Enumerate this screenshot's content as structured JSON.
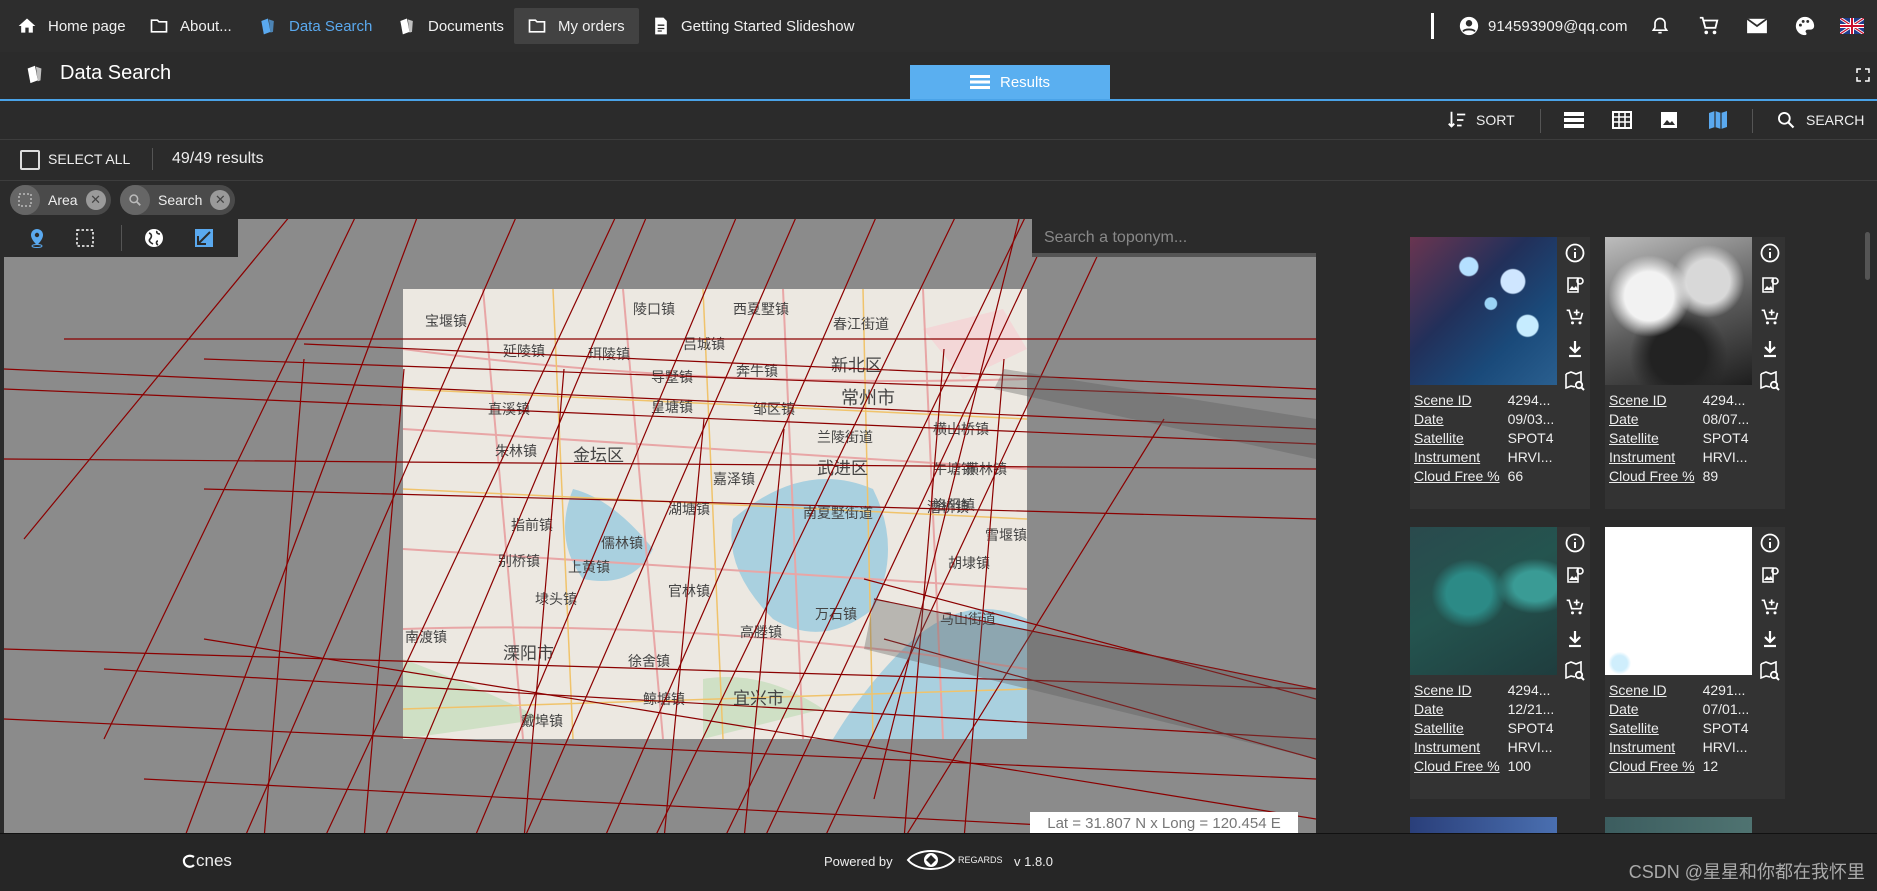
{
  "nav": {
    "items": [
      {
        "label": "Home page",
        "icon": "home-icon"
      },
      {
        "label": "About...",
        "icon": "folder-icon"
      },
      {
        "label": "Data Search",
        "icon": "data-search-icon"
      },
      {
        "label": "Documents",
        "icon": "documents-icon"
      },
      {
        "label": "My orders",
        "icon": "folder-icon"
      },
      {
        "label": "Getting Started Slideshow",
        "icon": "document-icon"
      }
    ],
    "user_email": "914593909@qq.com",
    "accent": "#5aa9ef"
  },
  "page": {
    "title": "Data Search",
    "tab_results": "Results"
  },
  "toolbar": {
    "sort_label": "SORT",
    "search_label": "SEARCH"
  },
  "selection": {
    "select_all": "SELECT ALL",
    "count_text": "49/49 results"
  },
  "filters": [
    {
      "label": "Area",
      "icon": "area-icon"
    },
    {
      "label": "Search",
      "icon": "search-icon"
    }
  ],
  "map": {
    "toponym_placeholder": "Search a toponym...",
    "coordinates": "Lat = 31.807 N x Long = 120.454 E",
    "places": [
      "宝堰镇",
      "延陵镇",
      "珥陵镇",
      "吕城镇",
      "导墅镇",
      "皇塘镇",
      "陵口镇",
      "西夏墅镇",
      "春江街道",
      "新北区",
      "奔牛镇",
      "常州市",
      "横山桥镇",
      "邹区镇",
      "直溪镇",
      "朱林镇",
      "金坛区",
      "兰陵街道",
      "武进区",
      "牛塘镇",
      "嘉泽镇",
      "湖塘镇",
      "洛阳镇",
      "指前镇",
      "儒林镇",
      "南夏墅街道",
      "雪堰镇",
      "别桥镇",
      "上黄镇",
      "胡埭镇",
      "埭头镇",
      "官林镇",
      "万石镇",
      "高塍镇",
      "马山街道",
      "南渡镇",
      "溧阳市",
      "徐舍镇",
      "宜兴市",
      "鲸塘镇",
      "戴埠镇",
      "横林镇",
      "漕桥镇"
    ]
  },
  "results": [
    {
      "scene_id": "4294...",
      "date": "09/03...",
      "satellite": "SPOT4",
      "instrument": "HRVI...",
      "cloud_free": "66"
    },
    {
      "scene_id": "4294...",
      "date": "08/07...",
      "satellite": "SPOT4",
      "instrument": "HRVI...",
      "cloud_free": "89"
    },
    {
      "scene_id": "4294...",
      "date": "12/21...",
      "satellite": "SPOT4",
      "instrument": "HRVI...",
      "cloud_free": "100"
    },
    {
      "scene_id": "4291...",
      "date": "07/01...",
      "satellite": "SPOT4",
      "instrument": "HRVI...",
      "cloud_free": "12"
    }
  ],
  "result_labels": {
    "scene_id": "Scene ID",
    "date": "Date",
    "satellite": "Satellite",
    "instrument": "Instrument",
    "cloud_free": "Cloud Free %"
  },
  "footer": {
    "cnes": "cnes",
    "powered_by": "Powered by",
    "brand": "REGARDS",
    "version": "v 1.8.0"
  },
  "watermark": "CSDN @星星和你都在我怀里"
}
